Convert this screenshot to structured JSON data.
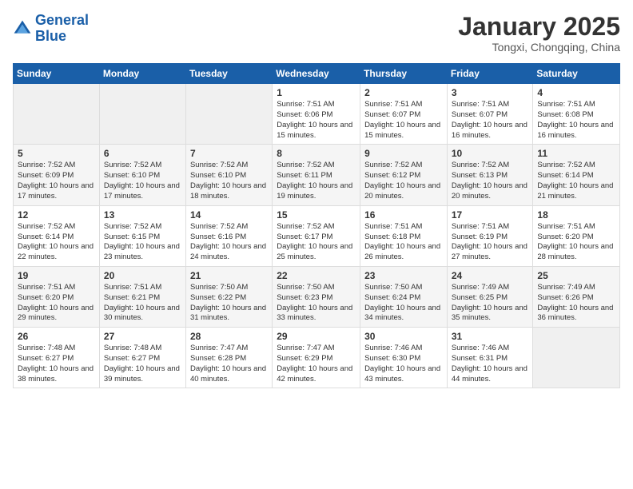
{
  "header": {
    "logo_line1": "General",
    "logo_line2": "Blue",
    "month_title": "January 2025",
    "location": "Tongxi, Chongqing, China"
  },
  "weekdays": [
    "Sunday",
    "Monday",
    "Tuesday",
    "Wednesday",
    "Thursday",
    "Friday",
    "Saturday"
  ],
  "weeks": [
    [
      {
        "day": "",
        "sunrise": "",
        "sunset": "",
        "daylight": ""
      },
      {
        "day": "",
        "sunrise": "",
        "sunset": "",
        "daylight": ""
      },
      {
        "day": "",
        "sunrise": "",
        "sunset": "",
        "daylight": ""
      },
      {
        "day": "1",
        "sunrise": "Sunrise: 7:51 AM",
        "sunset": "Sunset: 6:06 PM",
        "daylight": "Daylight: 10 hours and 15 minutes."
      },
      {
        "day": "2",
        "sunrise": "Sunrise: 7:51 AM",
        "sunset": "Sunset: 6:07 PM",
        "daylight": "Daylight: 10 hours and 15 minutes."
      },
      {
        "day": "3",
        "sunrise": "Sunrise: 7:51 AM",
        "sunset": "Sunset: 6:07 PM",
        "daylight": "Daylight: 10 hours and 16 minutes."
      },
      {
        "day": "4",
        "sunrise": "Sunrise: 7:51 AM",
        "sunset": "Sunset: 6:08 PM",
        "daylight": "Daylight: 10 hours and 16 minutes."
      }
    ],
    [
      {
        "day": "5",
        "sunrise": "Sunrise: 7:52 AM",
        "sunset": "Sunset: 6:09 PM",
        "daylight": "Daylight: 10 hours and 17 minutes."
      },
      {
        "day": "6",
        "sunrise": "Sunrise: 7:52 AM",
        "sunset": "Sunset: 6:10 PM",
        "daylight": "Daylight: 10 hours and 17 minutes."
      },
      {
        "day": "7",
        "sunrise": "Sunrise: 7:52 AM",
        "sunset": "Sunset: 6:10 PM",
        "daylight": "Daylight: 10 hours and 18 minutes."
      },
      {
        "day": "8",
        "sunrise": "Sunrise: 7:52 AM",
        "sunset": "Sunset: 6:11 PM",
        "daylight": "Daylight: 10 hours and 19 minutes."
      },
      {
        "day": "9",
        "sunrise": "Sunrise: 7:52 AM",
        "sunset": "Sunset: 6:12 PM",
        "daylight": "Daylight: 10 hours and 20 minutes."
      },
      {
        "day": "10",
        "sunrise": "Sunrise: 7:52 AM",
        "sunset": "Sunset: 6:13 PM",
        "daylight": "Daylight: 10 hours and 20 minutes."
      },
      {
        "day": "11",
        "sunrise": "Sunrise: 7:52 AM",
        "sunset": "Sunset: 6:14 PM",
        "daylight": "Daylight: 10 hours and 21 minutes."
      }
    ],
    [
      {
        "day": "12",
        "sunrise": "Sunrise: 7:52 AM",
        "sunset": "Sunset: 6:14 PM",
        "daylight": "Daylight: 10 hours and 22 minutes."
      },
      {
        "day": "13",
        "sunrise": "Sunrise: 7:52 AM",
        "sunset": "Sunset: 6:15 PM",
        "daylight": "Daylight: 10 hours and 23 minutes."
      },
      {
        "day": "14",
        "sunrise": "Sunrise: 7:52 AM",
        "sunset": "Sunset: 6:16 PM",
        "daylight": "Daylight: 10 hours and 24 minutes."
      },
      {
        "day": "15",
        "sunrise": "Sunrise: 7:52 AM",
        "sunset": "Sunset: 6:17 PM",
        "daylight": "Daylight: 10 hours and 25 minutes."
      },
      {
        "day": "16",
        "sunrise": "Sunrise: 7:51 AM",
        "sunset": "Sunset: 6:18 PM",
        "daylight": "Daylight: 10 hours and 26 minutes."
      },
      {
        "day": "17",
        "sunrise": "Sunrise: 7:51 AM",
        "sunset": "Sunset: 6:19 PM",
        "daylight": "Daylight: 10 hours and 27 minutes."
      },
      {
        "day": "18",
        "sunrise": "Sunrise: 7:51 AM",
        "sunset": "Sunset: 6:20 PM",
        "daylight": "Daylight: 10 hours and 28 minutes."
      }
    ],
    [
      {
        "day": "19",
        "sunrise": "Sunrise: 7:51 AM",
        "sunset": "Sunset: 6:20 PM",
        "daylight": "Daylight: 10 hours and 29 minutes."
      },
      {
        "day": "20",
        "sunrise": "Sunrise: 7:51 AM",
        "sunset": "Sunset: 6:21 PM",
        "daylight": "Daylight: 10 hours and 30 minutes."
      },
      {
        "day": "21",
        "sunrise": "Sunrise: 7:50 AM",
        "sunset": "Sunset: 6:22 PM",
        "daylight": "Daylight: 10 hours and 31 minutes."
      },
      {
        "day": "22",
        "sunrise": "Sunrise: 7:50 AM",
        "sunset": "Sunset: 6:23 PM",
        "daylight": "Daylight: 10 hours and 33 minutes."
      },
      {
        "day": "23",
        "sunrise": "Sunrise: 7:50 AM",
        "sunset": "Sunset: 6:24 PM",
        "daylight": "Daylight: 10 hours and 34 minutes."
      },
      {
        "day": "24",
        "sunrise": "Sunrise: 7:49 AM",
        "sunset": "Sunset: 6:25 PM",
        "daylight": "Daylight: 10 hours and 35 minutes."
      },
      {
        "day": "25",
        "sunrise": "Sunrise: 7:49 AM",
        "sunset": "Sunset: 6:26 PM",
        "daylight": "Daylight: 10 hours and 36 minutes."
      }
    ],
    [
      {
        "day": "26",
        "sunrise": "Sunrise: 7:48 AM",
        "sunset": "Sunset: 6:27 PM",
        "daylight": "Daylight: 10 hours and 38 minutes."
      },
      {
        "day": "27",
        "sunrise": "Sunrise: 7:48 AM",
        "sunset": "Sunset: 6:27 PM",
        "daylight": "Daylight: 10 hours and 39 minutes."
      },
      {
        "day": "28",
        "sunrise": "Sunrise: 7:47 AM",
        "sunset": "Sunset: 6:28 PM",
        "daylight": "Daylight: 10 hours and 40 minutes."
      },
      {
        "day": "29",
        "sunrise": "Sunrise: 7:47 AM",
        "sunset": "Sunset: 6:29 PM",
        "daylight": "Daylight: 10 hours and 42 minutes."
      },
      {
        "day": "30",
        "sunrise": "Sunrise: 7:46 AM",
        "sunset": "Sunset: 6:30 PM",
        "daylight": "Daylight: 10 hours and 43 minutes."
      },
      {
        "day": "31",
        "sunrise": "Sunrise: 7:46 AM",
        "sunset": "Sunset: 6:31 PM",
        "daylight": "Daylight: 10 hours and 44 minutes."
      },
      {
        "day": "",
        "sunrise": "",
        "sunset": "",
        "daylight": ""
      }
    ]
  ]
}
